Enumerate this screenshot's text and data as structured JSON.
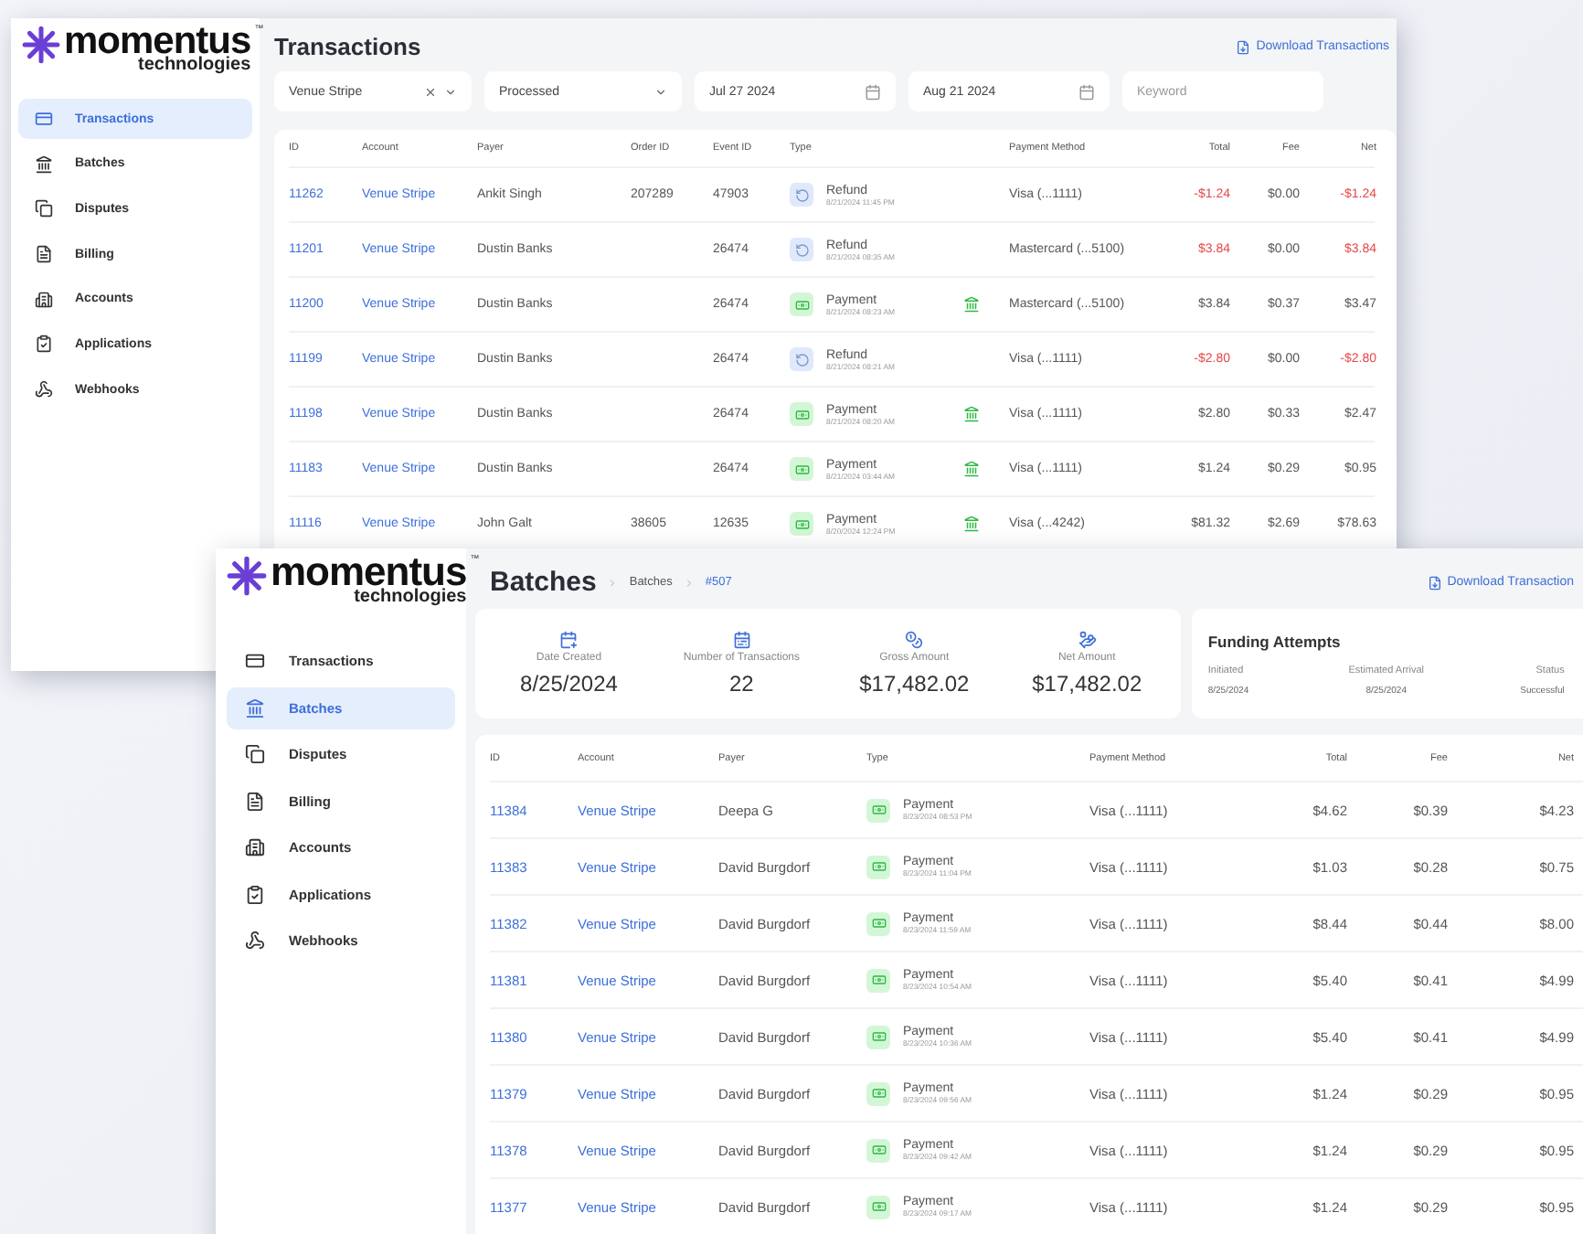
{
  "transactions_window": {
    "brand": {
      "name": "momentus",
      "tagline": "technologies",
      "mark": "™"
    },
    "sidebar": {
      "items": [
        {
          "label": "Transactions",
          "selected": true
        },
        {
          "label": "Batches",
          "selected": false
        },
        {
          "label": "Disputes",
          "selected": false
        },
        {
          "label": "Billing",
          "selected": false
        },
        {
          "label": "Accounts",
          "selected": false
        },
        {
          "label": "Applications",
          "selected": false
        },
        {
          "label": "Webhooks",
          "selected": false
        }
      ]
    },
    "title": "Transactions",
    "download": "Download Transactions",
    "filters": [
      {
        "kind": "select",
        "value": "Venue Stripe",
        "clearable": true
      },
      {
        "kind": "select",
        "value": "Processed",
        "clearable": false
      },
      {
        "kind": "date",
        "value": "Jul 27 2024"
      },
      {
        "kind": "date",
        "value": "Aug 21 2024"
      },
      {
        "kind": "text",
        "placeholder": "Keyword"
      }
    ],
    "table": {
      "columns": [
        "ID",
        "Account",
        "Payer",
        "Order ID",
        "Event ID",
        "Type",
        "Payment Method",
        "Total",
        "Fee",
        "Net"
      ],
      "rows": [
        {
          "id": "11262",
          "account": "Venue Stripe",
          "payer": "Ankit Singh",
          "order_id": "207289",
          "event_id": "47903",
          "kind": "refund",
          "type": "Refund",
          "time": "8/21/2024 11:45 PM",
          "payment_method": "Visa (...1111)",
          "total": "-$1.24",
          "fee": "$0.00",
          "net": "-$1.24"
        },
        {
          "id": "11201",
          "account": "Venue Stripe",
          "payer": "Dustin Banks",
          "order_id": "",
          "event_id": "26474",
          "kind": "refund",
          "type": "Refund",
          "time": "8/21/2024 08:35 AM",
          "payment_method": "Mastercard (...5100)",
          "total": "$3.84",
          "fee": "$0.00",
          "net": "$3.84"
        },
        {
          "id": "11200",
          "account": "Venue Stripe",
          "payer": "Dustin Banks",
          "order_id": "",
          "event_id": "26474",
          "kind": "payment",
          "type": "Payment",
          "time": "8/21/2024 08:23 AM",
          "payment_method": "Mastercard (...5100)",
          "total": "$3.84",
          "fee": "$0.37",
          "net": "$3.47"
        },
        {
          "id": "11199",
          "account": "Venue Stripe",
          "payer": "Dustin Banks",
          "order_id": "",
          "event_id": "26474",
          "kind": "refund",
          "type": "Refund",
          "time": "8/21/2024 08:21 AM",
          "payment_method": "Visa (...1111)",
          "total": "-$2.80",
          "fee": "$0.00",
          "net": "-$2.80"
        },
        {
          "id": "11198",
          "account": "Venue Stripe",
          "payer": "Dustin Banks",
          "order_id": "",
          "event_id": "26474",
          "kind": "payment",
          "type": "Payment",
          "time": "8/21/2024 08:20 AM",
          "payment_method": "Visa (...1111)",
          "total": "$2.80",
          "fee": "$0.33",
          "net": "$2.47"
        },
        {
          "id": "11183",
          "account": "Venue Stripe",
          "payer": "Dustin Banks",
          "order_id": "",
          "event_id": "26474",
          "kind": "payment",
          "type": "Payment",
          "time": "8/21/2024 03:44 AM",
          "payment_method": "Visa (...1111)",
          "total": "$1.24",
          "fee": "$0.29",
          "net": "$0.95"
        },
        {
          "id": "11116",
          "account": "Venue Stripe",
          "payer": "John Galt",
          "order_id": "38605",
          "event_id": "12635",
          "kind": "payment",
          "type": "Payment",
          "time": "8/20/2024 12:24 PM",
          "payment_method": "Visa (...4242)",
          "total": "$81.32",
          "fee": "$2.69",
          "net": "$78.63"
        }
      ]
    }
  },
  "batches_window": {
    "brand": {
      "name": "momentus",
      "tagline": "technologies",
      "mark": "™"
    },
    "sidebar": {
      "items": [
        {
          "label": "Transactions",
          "selected": false
        },
        {
          "label": "Batches",
          "selected": true
        },
        {
          "label": "Disputes",
          "selected": false
        },
        {
          "label": "Billing",
          "selected": false
        },
        {
          "label": "Accounts",
          "selected": false
        },
        {
          "label": "Applications",
          "selected": false
        },
        {
          "label": "Webhooks",
          "selected": false
        }
      ]
    },
    "title": "Batches",
    "breadcrumbs": [
      "Batches",
      "#507"
    ],
    "download": "Download Transaction",
    "stats": [
      {
        "label": "Date Created",
        "value": "8/25/2024"
      },
      {
        "label": "Number of Transactions",
        "value": "22"
      },
      {
        "label": "Gross Amount",
        "value": "$17,482.02"
      },
      {
        "label": "Net Amount",
        "value": "$17,482.02"
      }
    ],
    "funding": {
      "title": "Funding Attempts",
      "columns": [
        "Initiated",
        "Estimated Arrival",
        "Status"
      ],
      "values": [
        "8/25/2024",
        "8/25/2024",
        "Successful"
      ]
    },
    "table": {
      "columns": [
        "ID",
        "Account",
        "Payer",
        "Type",
        "Payment Method",
        "Total",
        "Fee",
        "Net"
      ],
      "rows": [
        {
          "id": "11384",
          "account": "Venue Stripe",
          "payer": "Deepa G",
          "kind": "payment",
          "type": "Payment",
          "time": "8/23/2024 08:53 PM",
          "payment_method": "Visa (...1111)",
          "total": "$4.62",
          "fee": "$0.39",
          "net": "$4.23"
        },
        {
          "id": "11383",
          "account": "Venue Stripe",
          "payer": "David Burgdorf",
          "kind": "payment",
          "type": "Payment",
          "time": "8/23/2024 11:04 PM",
          "payment_method": "Visa (...1111)",
          "total": "$1.03",
          "fee": "$0.28",
          "net": "$0.75"
        },
        {
          "id": "11382",
          "account": "Venue Stripe",
          "payer": "David Burgdorf",
          "kind": "payment",
          "type": "Payment",
          "time": "8/23/2024 11:59 AM",
          "payment_method": "Visa (...1111)",
          "total": "$8.44",
          "fee": "$0.44",
          "net": "$8.00"
        },
        {
          "id": "11381",
          "account": "Venue Stripe",
          "payer": "David Burgdorf",
          "kind": "payment",
          "type": "Payment",
          "time": "8/23/2024 10:54 AM",
          "payment_method": "Visa (...1111)",
          "total": "$5.40",
          "fee": "$0.41",
          "net": "$4.99"
        },
        {
          "id": "11380",
          "account": "Venue Stripe",
          "payer": "David Burgdorf",
          "kind": "payment",
          "type": "Payment",
          "time": "8/23/2024 10:36 AM",
          "payment_method": "Visa (...1111)",
          "total": "$5.40",
          "fee": "$0.41",
          "net": "$4.99"
        },
        {
          "id": "11379",
          "account": "Venue Stripe",
          "payer": "David Burgdorf",
          "kind": "payment",
          "type": "Payment",
          "time": "8/23/2024 09:56 AM",
          "payment_method": "Visa (...1111)",
          "total": "$1.24",
          "fee": "$0.29",
          "net": "$0.95"
        },
        {
          "id": "11378",
          "account": "Venue Stripe",
          "payer": "David Burgdorf",
          "kind": "payment",
          "type": "Payment",
          "time": "8/23/2024 09:42 AM",
          "payment_method": "Visa (...1111)",
          "total": "$1.24",
          "fee": "$0.29",
          "net": "$0.95"
        },
        {
          "id": "11377",
          "account": "Venue Stripe",
          "payer": "David Burgdorf",
          "kind": "payment",
          "type": "Payment",
          "time": "8/23/2024 09:17 AM",
          "payment_method": "Visa (...1111)",
          "total": "$1.24",
          "fee": "$0.29",
          "net": "$0.95"
        }
      ]
    }
  }
}
